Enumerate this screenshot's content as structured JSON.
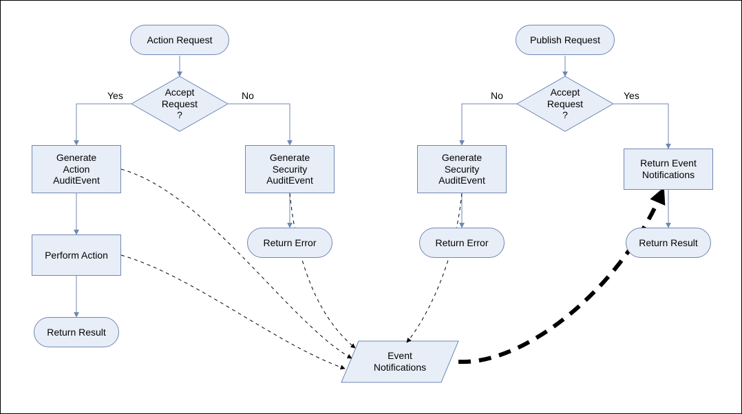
{
  "left": {
    "start": "Action Request",
    "decision": "Accept\nRequest\n?",
    "yes_label": "Yes",
    "no_label": "No",
    "yes_box": "Generate\nAction\nAuditEvent",
    "perform": "Perform Action",
    "result": "Return Result",
    "no_box": "Generate\nSecurity\nAuditEvent",
    "error": "Return Error"
  },
  "right": {
    "start": "Publish Request",
    "decision": "Accept\nRequest\n?",
    "yes_label": "Yes",
    "no_label": "No",
    "no_box": "Generate\nSecurity\nAuditEvent",
    "error": "Return Error",
    "yes_box": "Return Event\nNotifications",
    "result": "Return Result"
  },
  "center": {
    "event_notifications": "Event\nNotifications"
  },
  "colors": {
    "fill": "#E8EEF7",
    "stroke": "#6F86B4",
    "arrow": "#6F86B4"
  }
}
